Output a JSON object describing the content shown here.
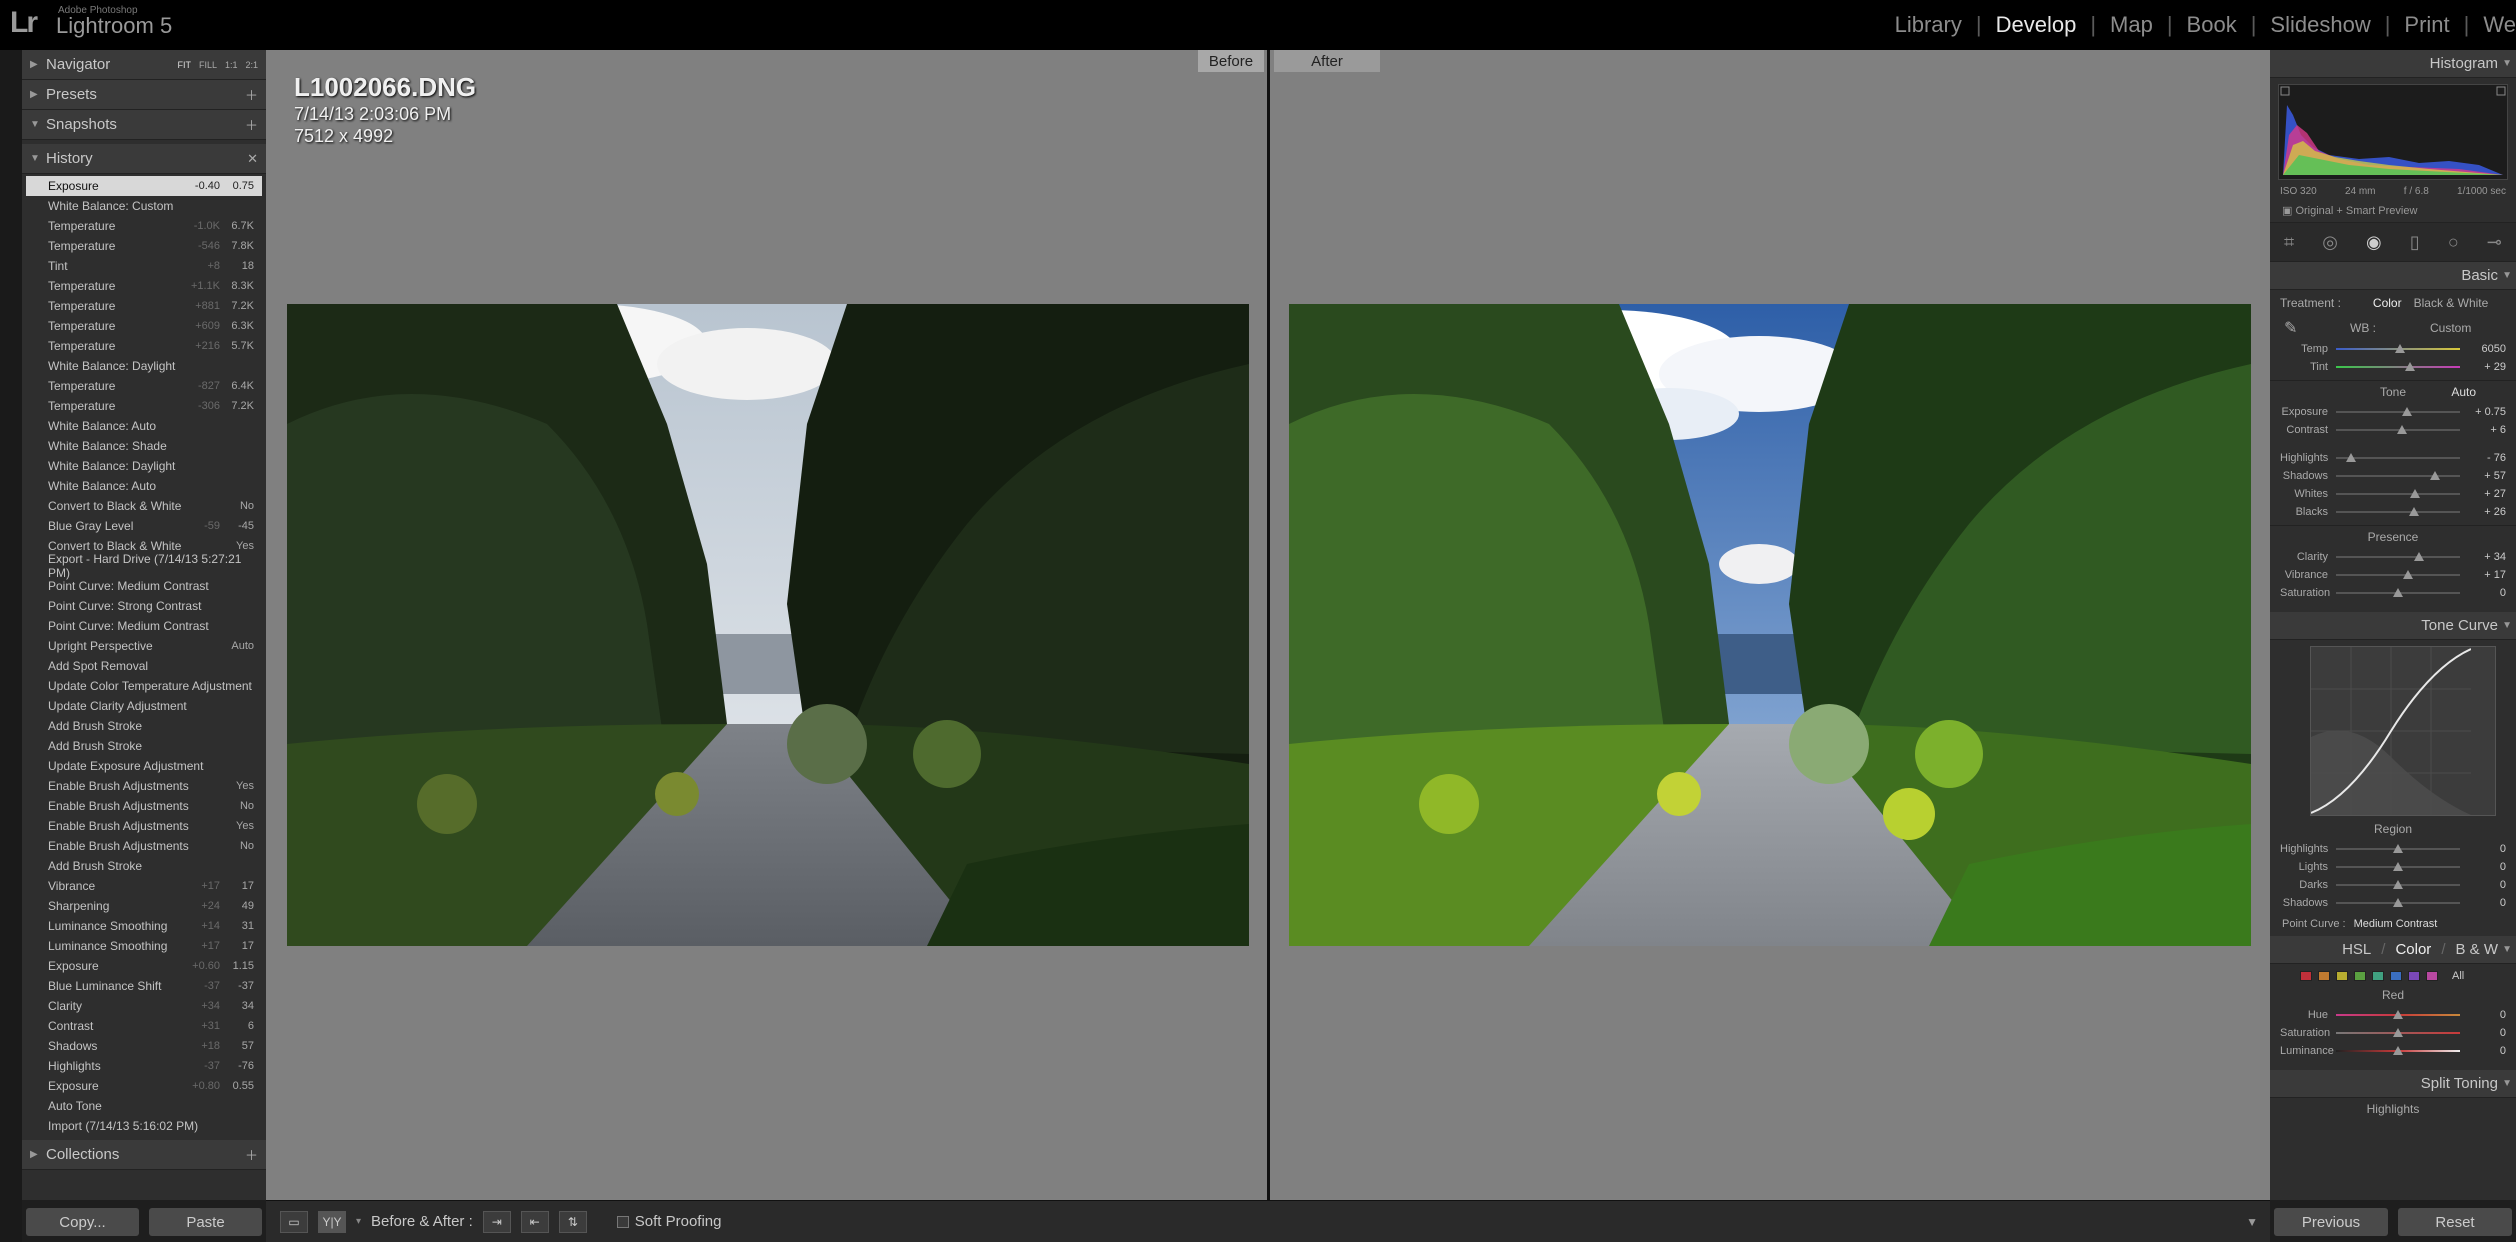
{
  "app": {
    "vendor": "Adobe Photoshop",
    "name": "Lightroom 5",
    "logo": "Lr"
  },
  "modules": [
    "Library",
    "Develop",
    "Map",
    "Book",
    "Slideshow",
    "Print",
    "We"
  ],
  "active_module": "Develop",
  "left_panel": {
    "navigator": {
      "title": "Navigator",
      "modes": [
        "FIT",
        "FILL",
        "1:1",
        "2:1"
      ]
    },
    "presets": {
      "title": "Presets"
    },
    "snapshots": {
      "title": "Snapshots"
    },
    "history": {
      "title": "History",
      "items": [
        {
          "label": "Exposure",
          "v1": "-0.40",
          "v2": "0.75"
        },
        {
          "label": "White Balance: Custom",
          "v1": "",
          "v2": ""
        },
        {
          "label": "Temperature",
          "v1": "-1.0K",
          "v2": "6.7K"
        },
        {
          "label": "Temperature",
          "v1": "-546",
          "v2": "7.8K"
        },
        {
          "label": "Tint",
          "v1": "+8",
          "v2": "18"
        },
        {
          "label": "Temperature",
          "v1": "+1.1K",
          "v2": "8.3K"
        },
        {
          "label": "Temperature",
          "v1": "+881",
          "v2": "7.2K"
        },
        {
          "label": "Temperature",
          "v1": "+609",
          "v2": "6.3K"
        },
        {
          "label": "Temperature",
          "v1": "+216",
          "v2": "5.7K"
        },
        {
          "label": "White Balance: Daylight",
          "v1": "",
          "v2": ""
        },
        {
          "label": "Temperature",
          "v1": "-827",
          "v2": "6.4K"
        },
        {
          "label": "Temperature",
          "v1": "-306",
          "v2": "7.2K"
        },
        {
          "label": "White Balance: Auto",
          "v1": "",
          "v2": ""
        },
        {
          "label": "White Balance: Shade",
          "v1": "",
          "v2": ""
        },
        {
          "label": "White Balance: Daylight",
          "v1": "",
          "v2": ""
        },
        {
          "label": "White Balance: Auto",
          "v1": "",
          "v2": ""
        },
        {
          "label": "Convert to Black & White",
          "v1": "",
          "v2": "No"
        },
        {
          "label": "Blue Gray Level",
          "v1": "-59",
          "v2": "-45"
        },
        {
          "label": "Convert to Black & White",
          "v1": "",
          "v2": "Yes"
        },
        {
          "label": "Export - Hard Drive (7/14/13 5:27:21 PM)",
          "v1": "",
          "v2": ""
        },
        {
          "label": "Point Curve: Medium Contrast",
          "v1": "",
          "v2": ""
        },
        {
          "label": "Point Curve: Strong Contrast",
          "v1": "",
          "v2": ""
        },
        {
          "label": "Point Curve: Medium Contrast",
          "v1": "",
          "v2": ""
        },
        {
          "label": "Upright Perspective",
          "v1": "",
          "v2": "Auto"
        },
        {
          "label": "Add Spot Removal",
          "v1": "",
          "v2": ""
        },
        {
          "label": "Update Color Temperature Adjustment",
          "v1": "",
          "v2": ""
        },
        {
          "label": "Update Clarity Adjustment",
          "v1": "",
          "v2": ""
        },
        {
          "label": "Add Brush Stroke",
          "v1": "",
          "v2": ""
        },
        {
          "label": "Add Brush Stroke",
          "v1": "",
          "v2": ""
        },
        {
          "label": "Update Exposure Adjustment",
          "v1": "",
          "v2": ""
        },
        {
          "label": "Enable Brush Adjustments",
          "v1": "",
          "v2": "Yes"
        },
        {
          "label": "Enable Brush Adjustments",
          "v1": "",
          "v2": "No"
        },
        {
          "label": "Enable Brush Adjustments",
          "v1": "",
          "v2": "Yes"
        },
        {
          "label": "Enable Brush Adjustments",
          "v1": "",
          "v2": "No"
        },
        {
          "label": "Add Brush Stroke",
          "v1": "",
          "v2": ""
        },
        {
          "label": "Vibrance",
          "v1": "+17",
          "v2": "17"
        },
        {
          "label": "Sharpening",
          "v1": "+24",
          "v2": "49"
        },
        {
          "label": "Luminance Smoothing",
          "v1": "+14",
          "v2": "31"
        },
        {
          "label": "Luminance Smoothing",
          "v1": "+17",
          "v2": "17"
        },
        {
          "label": "Exposure",
          "v1": "+0.60",
          "v2": "1.15"
        },
        {
          "label": "Blue Luminance Shift",
          "v1": "-37",
          "v2": "-37"
        },
        {
          "label": "Clarity",
          "v1": "+34",
          "v2": "34"
        },
        {
          "label": "Contrast",
          "v1": "+31",
          "v2": "6"
        },
        {
          "label": "Shadows",
          "v1": "+18",
          "v2": "57"
        },
        {
          "label": "Highlights",
          "v1": "-37",
          "v2": "-76"
        },
        {
          "label": "Exposure",
          "v1": "+0.80",
          "v2": "0.55"
        },
        {
          "label": "Auto Tone",
          "v1": "",
          "v2": ""
        },
        {
          "label": "Import (7/14/13 5:16:02 PM)",
          "v1": "",
          "v2": ""
        }
      ]
    },
    "collections": {
      "title": "Collections"
    },
    "copy_label": "Copy...",
    "paste_label": "Paste"
  },
  "center": {
    "file_name": "L1002066.DNG",
    "file_date": "7/14/13 2:03:06 PM",
    "file_dims": "7512 x 4992",
    "before_label": "Before",
    "after_label": "After"
  },
  "toolbar": {
    "view_mode": "Y|Y",
    "before_after_label": "Before & After :",
    "soft_proofing_label": "Soft Proofing"
  },
  "right_panel": {
    "histogram": {
      "title": "Histogram",
      "iso": "ISO 320",
      "focal": "24 mm",
      "aperture": "f / 6.8",
      "shutter": "1/1000 sec",
      "preview_label": "Original + Smart Preview"
    },
    "basic": {
      "title": "Basic",
      "treatment_label": "Treatment :",
      "treatment_options": [
        "Color",
        "Black & White"
      ],
      "wb_label": "WB :",
      "wb_value": "Custom",
      "temp_sliders": [
        {
          "label": "Temp",
          "value": "6050",
          "pos": 0.52
        },
        {
          "label": "Tint",
          "value": "+ 29",
          "pos": 0.6
        }
      ],
      "tone_label": "Tone",
      "auto_label": "Auto",
      "tone_sliders": [
        {
          "label": "Exposure",
          "value": "+ 0.75",
          "pos": 0.57
        },
        {
          "label": "Contrast",
          "value": "+ 6",
          "pos": 0.53
        }
      ],
      "tone_sliders2": [
        {
          "label": "Highlights",
          "value": "- 76",
          "pos": 0.12
        },
        {
          "label": "Shadows",
          "value": "+ 57",
          "pos": 0.8
        },
        {
          "label": "Whites",
          "value": "+ 27",
          "pos": 0.64
        },
        {
          "label": "Blacks",
          "value": "+ 26",
          "pos": 0.63
        }
      ],
      "presence_label": "Presence",
      "presence_sliders": [
        {
          "label": "Clarity",
          "value": "+ 34",
          "pos": 0.67
        },
        {
          "label": "Vibrance",
          "value": "+ 17",
          "pos": 0.58
        },
        {
          "label": "Saturation",
          "value": "0",
          "pos": 0.5
        }
      ]
    },
    "tone_curve": {
      "title": "Tone Curve",
      "region_label": "Region",
      "sliders": [
        {
          "label": "Highlights",
          "value": "0",
          "pos": 0.5
        },
        {
          "label": "Lights",
          "value": "0",
          "pos": 0.5
        },
        {
          "label": "Darks",
          "value": "0",
          "pos": 0.5
        },
        {
          "label": "Shadows",
          "value": "0",
          "pos": 0.5
        }
      ],
      "point_curve_label": "Point Curve :",
      "point_curve_value": "Medium Contrast"
    },
    "hsl": {
      "tabs": [
        "HSL",
        "Color",
        "B & W"
      ],
      "all_label": "All",
      "swatch_colors": [
        "#c0303a",
        "#c07a30",
        "#b8ad30",
        "#5aa040",
        "#40a080",
        "#3a6ec0",
        "#7a48b8",
        "#b848a0"
      ],
      "channel_label": "Red",
      "sliders": [
        {
          "label": "Hue",
          "value": "0",
          "pos": 0.5
        },
        {
          "label": "Saturation",
          "value": "0",
          "pos": 0.5
        },
        {
          "label": "Luminance",
          "value": "0",
          "pos": 0.5
        }
      ]
    },
    "split_toning": {
      "title": "Split Toning",
      "highlights_label": "Highlights"
    },
    "previous_label": "Previous",
    "reset_label": "Reset"
  }
}
